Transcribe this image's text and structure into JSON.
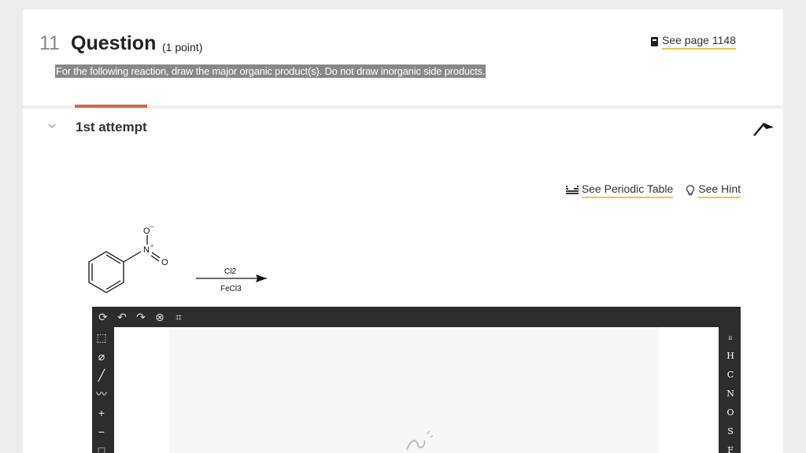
{
  "question": {
    "number": "11",
    "title": "Question",
    "points": "(1 point)",
    "see_page": "See page 1148",
    "prompt": "For the following reaction, draw the major organic product(s). Do not draw inorganic side products."
  },
  "attempt": {
    "label": "1st attempt"
  },
  "links": {
    "periodic_table": "See Periodic Table",
    "hint": "See Hint"
  },
  "reaction": {
    "reagent_top": "Cl2",
    "reagent_bottom": "FeCl3",
    "substituent_o_top": "O",
    "substituent_n": "N",
    "substituent_o_right": "O"
  },
  "editor": {
    "elements": [
      "H",
      "C",
      "N",
      "O",
      "S",
      "F"
    ]
  },
  "colors": {
    "accent_tab": "#e0644b",
    "link_underline": "#e8c84a",
    "editor_frame": "#2d2d2d"
  }
}
